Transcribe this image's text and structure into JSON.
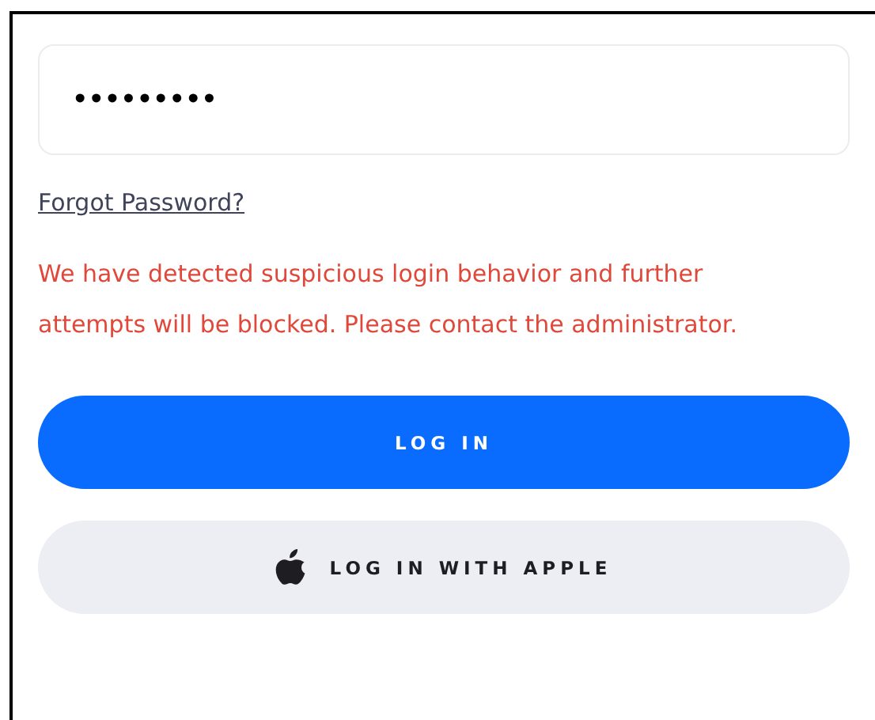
{
  "password_field": {
    "value": "•••••••••"
  },
  "forgot_link": "Forgot Password?",
  "error_message": "We have detected suspicious login behavior and further attempts will be blocked. Please contact the administrator.",
  "buttons": [
    {
      "kind": "primary",
      "label": "LOG IN"
    },
    {
      "kind": "apple",
      "label": "LOG IN WITH APPLE"
    }
  ]
}
